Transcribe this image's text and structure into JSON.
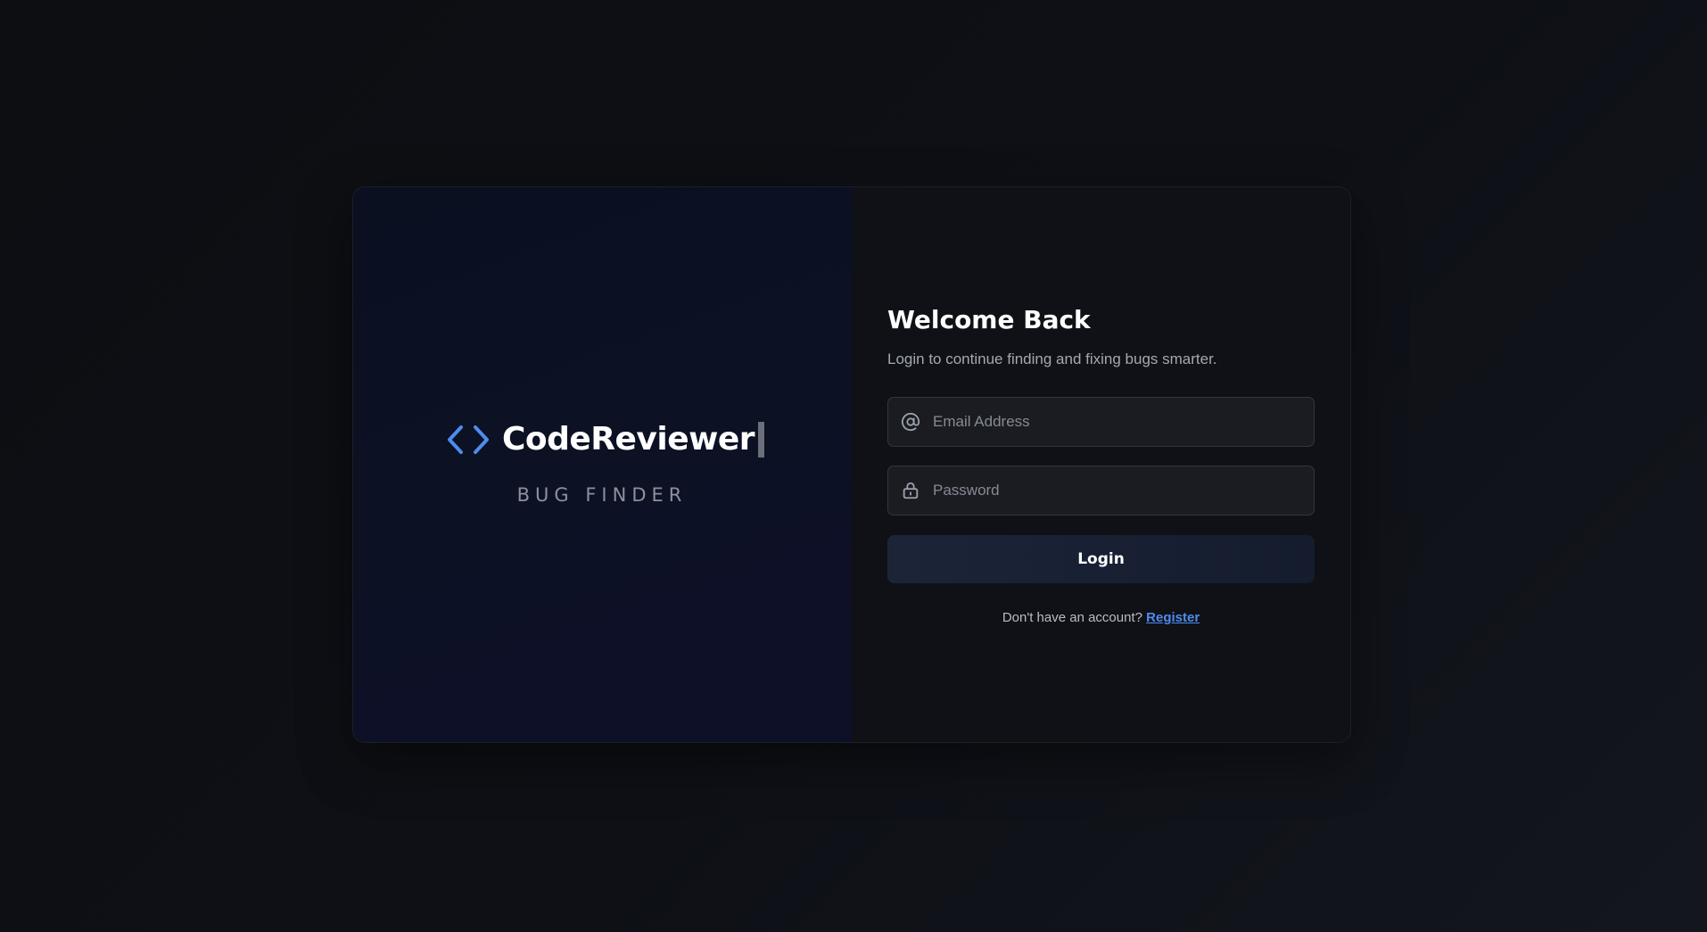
{
  "brand": {
    "name": "CodeReviewer",
    "tagline": "BUG FINDER",
    "icon": "code-brackets-icon",
    "accent_color": "#4e8cf0"
  },
  "login": {
    "title": "Welcome Back",
    "subtitle": "Login to continue finding and fixing bugs smarter.",
    "email": {
      "placeholder": "Email Address",
      "value": "",
      "icon": "at-sign-icon"
    },
    "password": {
      "placeholder": "Password",
      "value": "",
      "icon": "lock-icon"
    },
    "button_label": "Login",
    "register_prompt": "Don't have an account?",
    "register_link": "Register"
  }
}
